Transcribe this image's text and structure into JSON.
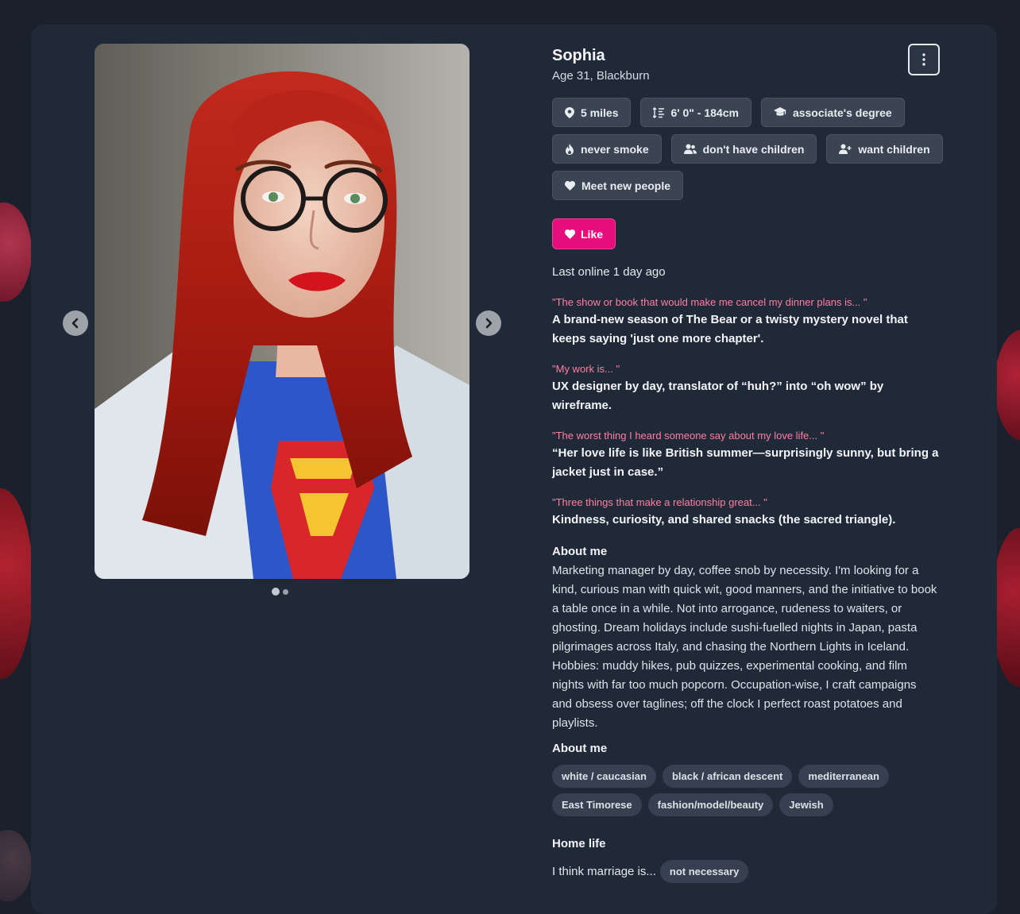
{
  "profile": {
    "name": "Sophia",
    "subtitle": "Age 31, Blackburn",
    "last_online": "Last online 1 day ago"
  },
  "photo": {
    "current_index": 1,
    "total": 2,
    "alt": "Sophia profile photo"
  },
  "attributes": [
    {
      "icon": "location-pin-icon",
      "label": "5 miles"
    },
    {
      "icon": "height-ruler-icon",
      "label": "6' 0\" - 184cm"
    },
    {
      "icon": "graduation-cap-icon",
      "label": "associate's degree"
    },
    {
      "icon": "flame-icon",
      "label": "never smoke"
    },
    {
      "icon": "user-group-icon",
      "label": "don't have children"
    },
    {
      "icon": "user-plus-icon",
      "label": "want children"
    },
    {
      "icon": "heart-icon",
      "label": "Meet new people"
    }
  ],
  "actions": {
    "like_label": "Like"
  },
  "prompts": [
    {
      "question": "\"The show or book that would make me cancel my dinner plans is... \"",
      "answer": "A brand-new season of The Bear or a twisty mystery novel that keeps saying 'just one more chapter'."
    },
    {
      "question": "\"My work is... \"",
      "answer": "UX designer by day, translator of “huh?” into “oh wow” by wireframe."
    },
    {
      "question": "\"The worst thing I heard someone say about my love life... \"",
      "answer": "“Her love life is like British summer—surprisingly sunny, but bring a jacket just in case.”"
    },
    {
      "question": "\"Three things that make a relationship great... \"",
      "answer": "Kindness, curiosity, and shared snacks (the sacred triangle)."
    }
  ],
  "about": {
    "title": "About me",
    "text": "Marketing manager by day, coffee snob by necessity. I'm looking for a kind, curious man with quick wit, good manners, and the initiative to book a table once in a while. Not into arrogance, rudeness to waiters, or ghosting. Dream holidays include sushi-fuelled nights in Japan, pasta pilgrimages across Italy, and chasing the Northern Lights in Iceland. Hobbies: muddy hikes, pub quizzes, experimental cooking, and film nights with far too much popcorn. Occupation-wise, I craft campaigns and obsess over taglines; off the clock I perfect roast potatoes and playlists."
  },
  "about_tags": {
    "title": "About me",
    "tags": [
      "white / caucasian",
      "black / african descent",
      "mediterranean",
      "East Timorese",
      "fashion/model/beauty",
      "Jewish"
    ]
  },
  "home_life": {
    "title": "Home life",
    "marriage_prompt": "I think marriage is...",
    "marriage_value": "not necessary"
  },
  "colors": {
    "accent": "#e50e7c",
    "prompt_question": "#ff7fa0",
    "card": "#1f2938",
    "page": "#1a212d"
  }
}
